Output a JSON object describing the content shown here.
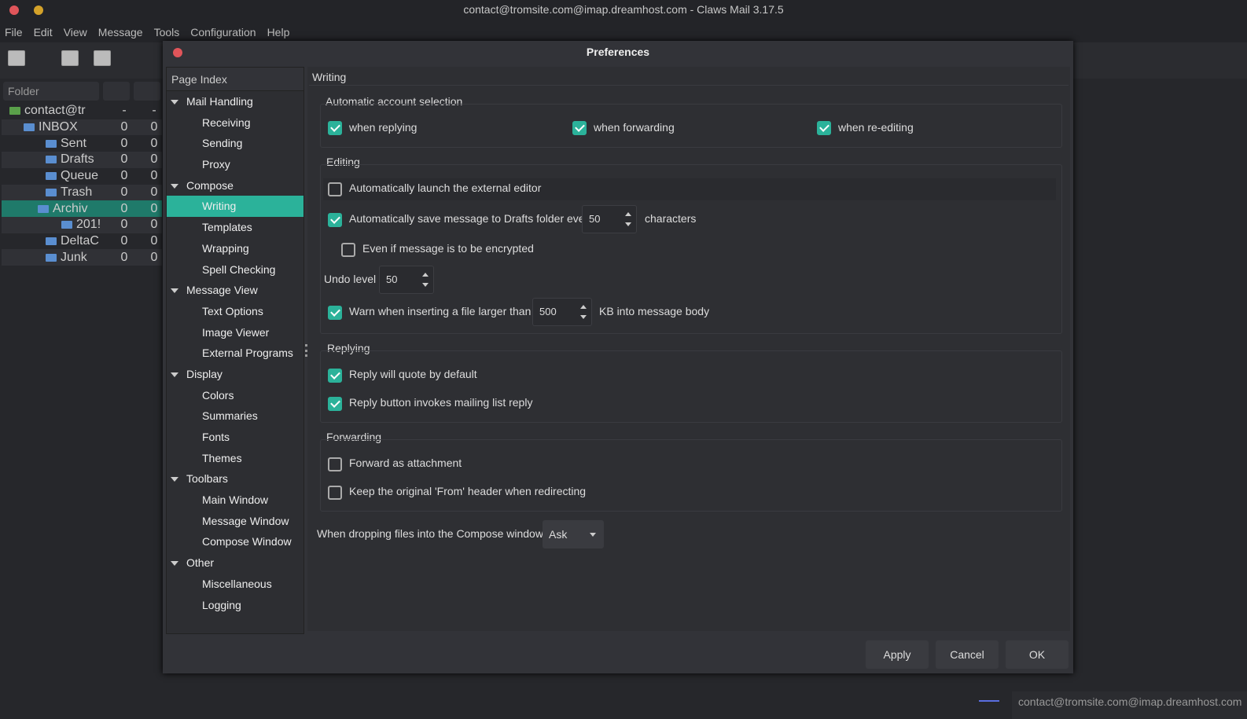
{
  "window": {
    "title": "contact@tromsite.com@imap.dreamhost.com - Claws Mail 3.17.5"
  },
  "menu": [
    "File",
    "Edit",
    "View",
    "Message",
    "Tools",
    "Configuration",
    "Help"
  ],
  "folders": {
    "header": "Folder",
    "rows": [
      {
        "name": "contact@tr",
        "unread": "-",
        "total": "-"
      },
      {
        "name": "INBOX",
        "unread": "0",
        "total": "0"
      },
      {
        "name": "Sent",
        "unread": "0",
        "total": "0"
      },
      {
        "name": "Drafts",
        "unread": "0",
        "total": "0"
      },
      {
        "name": "Queue",
        "unread": "0",
        "total": "0"
      },
      {
        "name": "Trash",
        "unread": "0",
        "total": "0"
      },
      {
        "name": "Archiv",
        "unread": "0",
        "total": "0"
      },
      {
        "name": "201!",
        "unread": "0",
        "total": "0"
      },
      {
        "name": "DeltaC",
        "unread": "0",
        "total": "0"
      },
      {
        "name": "Junk",
        "unread": "0",
        "total": "0"
      }
    ]
  },
  "dialog": {
    "title": "Preferences",
    "index_header": "Page Index",
    "index": [
      {
        "label": "Mail Handling",
        "level": 0
      },
      {
        "label": "Receiving",
        "level": 1
      },
      {
        "label": "Sending",
        "level": 1
      },
      {
        "label": "Proxy",
        "level": 1
      },
      {
        "label": "Compose",
        "level": 0
      },
      {
        "label": "Writing",
        "level": 1,
        "selected": true
      },
      {
        "label": "Templates",
        "level": 1
      },
      {
        "label": "Wrapping",
        "level": 1
      },
      {
        "label": "Spell Checking",
        "level": 1
      },
      {
        "label": "Message View",
        "level": 0
      },
      {
        "label": "Text Options",
        "level": 1
      },
      {
        "label": "Image Viewer",
        "level": 1
      },
      {
        "label": "External Programs",
        "level": 1
      },
      {
        "label": "Display",
        "level": 0
      },
      {
        "label": "Colors",
        "level": 1
      },
      {
        "label": "Summaries",
        "level": 1
      },
      {
        "label": "Fonts",
        "level": 1
      },
      {
        "label": "Themes",
        "level": 1
      },
      {
        "label": "Toolbars",
        "level": 0
      },
      {
        "label": "Main Window",
        "level": 1
      },
      {
        "label": "Message Window",
        "level": 1
      },
      {
        "label": "Compose Window",
        "level": 1
      },
      {
        "label": "Other",
        "level": 0
      },
      {
        "label": "Miscellaneous",
        "level": 1
      },
      {
        "label": "Logging",
        "level": 1
      }
    ],
    "page_title": "Writing",
    "auto_account": {
      "title": "Automatic account selection",
      "replying": "when replying",
      "forwarding": "when forwarding",
      "reediting": "when re-editing"
    },
    "editing": {
      "title": "Editing",
      "launch_editor": "Automatically launch the external editor",
      "autosave": "Automatically save message to Drafts folder every",
      "autosave_value": "50",
      "characters": "characters",
      "encrypted": "Even if message is to be encrypted",
      "undo_label": "Undo level",
      "undo_value": "50",
      "warn": "Warn when inserting a file larger than",
      "warn_value": "500",
      "warn_suffix": "KB into message body"
    },
    "replying": {
      "title": "Replying",
      "quote": "Reply will quote by default",
      "mlist": "Reply button invokes mailing list reply"
    },
    "forwarding": {
      "title": "Forwarding",
      "attach": "Forward as attachment",
      "keep_from": "Keep the original 'From' header when redirecting"
    },
    "drop_label": "When dropping files into the Compose window",
    "drop_value": "Ask",
    "buttons": {
      "apply": "Apply",
      "cancel": "Cancel",
      "ok": "OK"
    }
  },
  "statusbar": {
    "account": "contact@tromsite.com@imap.dreamhost.com"
  },
  "colors": {
    "accent": "#2bb29a"
  }
}
